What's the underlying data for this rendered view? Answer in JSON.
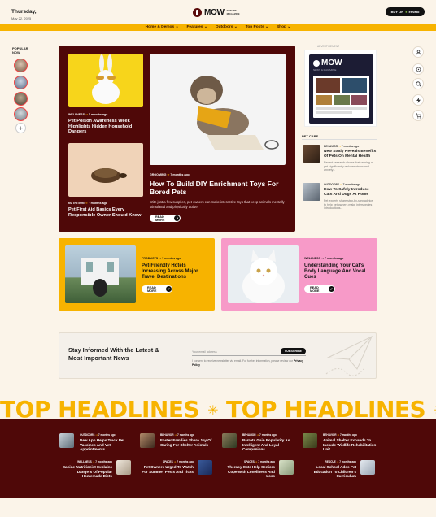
{
  "header": {
    "date_day": "Thursday,",
    "date_full": "May 22, 2025",
    "logo_text": "MOW",
    "logo_tagline": "NATURE MAGAZINE",
    "buy_label": "BUY ON",
    "buy_brand": "envato"
  },
  "nav": [
    "Home & Demos ⌄",
    "Features ⌄",
    "Outdoors ⌄",
    "Top Posts ⌄",
    "Shop ⌄"
  ],
  "popular": {
    "label_1": "POPULAR",
    "label_2": "NOW",
    "plus": "+"
  },
  "right_rail_icons": [
    "user-icon",
    "moon-icon",
    "search-icon",
    "bolt-icon",
    "cart-icon"
  ],
  "hero": {
    "left_top": {
      "tag": "WELLNESS",
      "time": "7 months ago",
      "title": "Pet Poison Awareness Week Highlights Hidden Household Dangers"
    },
    "left_bottom": {
      "tag": "NUTRITION",
      "time": "7 months ago",
      "title": "Pet First Aid Basics Every Responsible Owner Should Know"
    },
    "main": {
      "tag": "GROOMING",
      "time": "7 months ago",
      "title": "How To Build DIY Enrichment Toys For Bored Pets",
      "excerpt": "With just a few supplies, pet owners can make interactive toys that keep animals mentally stimulated and physically active.",
      "read_more": "READ MORE"
    }
  },
  "ad": {
    "label": "ADVERTISEMENT",
    "logo": "MOW",
    "sub": "NEWS & MAGAZINE"
  },
  "pet_care": {
    "heading": "PET CARE",
    "items": [
      {
        "tag": "BEHAVIOR",
        "time": "7 months ago",
        "title": "New Study Reveals Benefits Of Pets On Mental Health",
        "excerpt": "Recent research shows that owning a pet significantly reduces stress and anxiety..."
      },
      {
        "tag": "OUTDOORS",
        "time": "7 months ago",
        "title": "How To Safely Introduce Cats And Dogs At Home",
        "excerpt": "Pet experts share step-by-step advice to help pet owners make interspecies introductions..."
      }
    ]
  },
  "cards": [
    {
      "tag": "PRODUCTS",
      "time": "7 months ago",
      "title": "Pet-Friendly Hotels Increasing Across Major Travel Destinations",
      "read_more": "READ MORE",
      "bg": "#f7b300"
    },
    {
      "tag": "WELLNESS",
      "time": "7 months ago",
      "title": "Understanding Your Cat's Body Language And Vocal Cues",
      "read_more": "READ MORE",
      "bg": "#f79ac8"
    }
  ],
  "newsletter": {
    "title": "Stay Informed With the Latest & Most Important News",
    "placeholder": "Your email address",
    "button": "SUBSCRIBE",
    "legal": "I consent to receive newsletter via email. For further information, please review our",
    "legal_link": "Privacy Policy"
  },
  "marquee": {
    "text": "TOP HEADLINES",
    "star": "✳"
  },
  "headlines": [
    {
      "tag": "OUTDOORS",
      "time": "7 months ago",
      "title": "New App Helps Track Pet Vaccines And Vet Appointments"
    },
    {
      "tag": "BEHAVIOR",
      "time": "7 months ago",
      "title": "Foster Families Share Joy Of Caring For Shelter Animals"
    },
    {
      "tag": "BEHAVIOR",
      "time": "7 months ago",
      "title": "Parrots Gain Popularity As Intelligent And Loyal Companions"
    },
    {
      "tag": "BEHAVIOR",
      "time": "7 months ago",
      "title": "Animal Shelter Expands To Include Wildlife Rehabilitation Unit"
    },
    {
      "tag": "WELLNESS",
      "time": "7 months ago",
      "title": "Canine Nutritionist Explains Dangers Of Popular Homemade Diets"
    },
    {
      "tag": "SPACES",
      "time": "7 months ago",
      "title": "Pet Owners Urged To Watch For Summer Pests And Ticks"
    },
    {
      "tag": "SPACES",
      "time": "7 months ago",
      "title": "Therapy Cats Help Seniors Cope With Loneliness And Loss"
    },
    {
      "tag": "RESCUE",
      "time": "7 months ago",
      "title": "Local School Adds Pet Education To Children's Curriculum"
    }
  ],
  "colors": {
    "accent": "#f7b300",
    "maroon": "#4f0808",
    "pink": "#f79ac8",
    "bg": "#fbf4e9"
  }
}
